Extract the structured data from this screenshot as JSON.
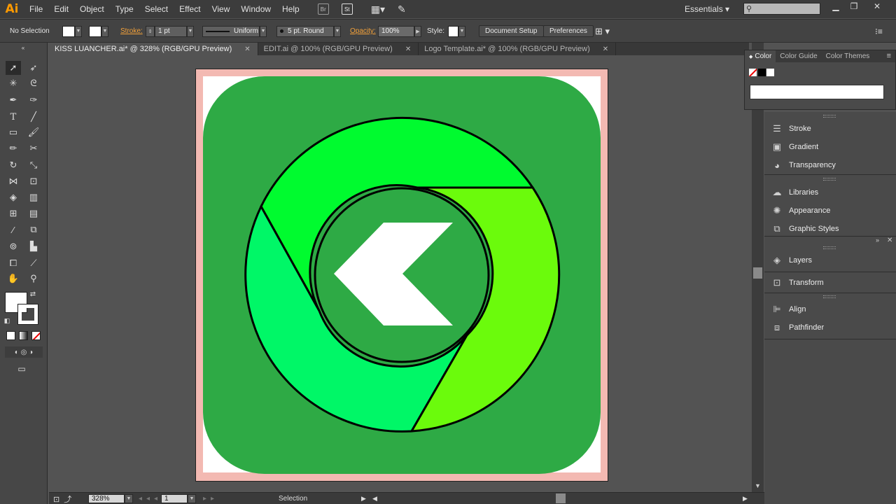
{
  "app": {
    "logo_text": "Ai"
  },
  "menu": [
    "File",
    "Edit",
    "Object",
    "Type",
    "Select",
    "Effect",
    "View",
    "Window",
    "Help"
  ],
  "menu_icons": {
    "bridge": "Br",
    "stock": "St"
  },
  "workspace": "Essentials",
  "control_bar": {
    "selection": "No Selection",
    "stroke_label": "Stroke:",
    "stroke_weight": "1 pt",
    "profile": "Uniform",
    "brush": "5 pt. Round",
    "opacity_label": "Opacity:",
    "opacity": "100%",
    "style_label": "Style:",
    "doc_setup": "Document Setup",
    "preferences": "Preferences"
  },
  "tabs": [
    {
      "title": "KISS LUANCHER.ai* @ 328% (RGB/GPU Preview)",
      "active": true
    },
    {
      "title": "EDIT.ai @ 100% (RGB/GPU Preview)",
      "active": false
    },
    {
      "title": "Logo Template.ai* @ 100% (RGB/GPU Preview)",
      "active": false
    }
  ],
  "color_panel": {
    "tabs": [
      "Color",
      "Color Guide",
      "Color Themes"
    ]
  },
  "panels": [
    {
      "label": "Stroke",
      "icon": "stroke-icon"
    },
    {
      "label": "Gradient",
      "icon": "gradient-icon"
    },
    {
      "label": "Transparency",
      "icon": "transparency-icon"
    },
    {
      "label": "Libraries",
      "icon": "libraries-icon"
    },
    {
      "label": "Appearance",
      "icon": "appearance-icon"
    },
    {
      "label": "Graphic Styles",
      "icon": "graphic-styles-icon"
    },
    {
      "label": "Layers",
      "icon": "layers-icon"
    },
    {
      "label": "Transform",
      "icon": "transform-icon"
    },
    {
      "label": "Align",
      "icon": "align-icon"
    },
    {
      "label": "Pathfinder",
      "icon": "pathfinder-icon"
    }
  ],
  "status": {
    "zoom": "328%",
    "artboard": "1",
    "tool": "Selection"
  },
  "colors": {
    "icon_bg": "#2eaa45",
    "artboard_bleed": "#f3b9b2",
    "ring_top": "#00fb2f",
    "ring_left": "#00f767",
    "ring_right": "#6bfb0c",
    "arrow": "#ffffff"
  }
}
